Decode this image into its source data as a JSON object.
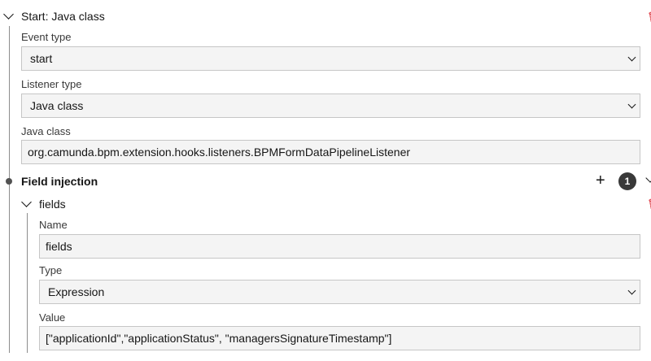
{
  "listener": {
    "header": "Start: Java class",
    "event_type": {
      "label": "Event type",
      "value": "start"
    },
    "listener_type": {
      "label": "Listener type",
      "value": "Java class"
    },
    "java_class": {
      "label": "Java class",
      "value": "org.camunda.bpm.extension.hooks.listeners.BPMFormDataPipelineListener"
    }
  },
  "field_injection": {
    "title": "Field injection",
    "count": "1",
    "item": {
      "header": "fields",
      "name": {
        "label": "Name",
        "value": "fields"
      },
      "type": {
        "label": "Type",
        "value": "Expression"
      },
      "value": {
        "label": "Value",
        "value": "[\"applicationId\",\"applicationStatus\", \"managersSignatureTimestamp\"]"
      }
    }
  },
  "icons": {
    "delete": "trash-icon",
    "collapse": "chevron-down-icon",
    "add": "plus-icon"
  },
  "colors": {
    "delete_icon": "#da1e28",
    "badge_bg": "#393939",
    "field_bg": "#f4f4f4"
  }
}
